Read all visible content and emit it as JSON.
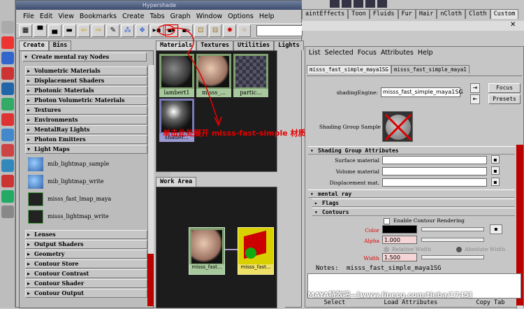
{
  "hypershade": {
    "title": "Hypershade",
    "menu": [
      "File",
      "Edit",
      "View",
      "Bookmarks",
      "Create",
      "Tabs",
      "Graph",
      "Window",
      "Options",
      "Help"
    ],
    "left_tabs": [
      "Create",
      "Bins"
    ],
    "create_header": "Create mental ray Nodes",
    "sections_top": [
      "Volumetric Materials",
      "Displacement Shaders",
      "Photonic Materials",
      "Photon Volumetric Materials",
      "Textures",
      "Environments",
      "MentalRay Lights",
      "Photon Emitters",
      "Light Maps"
    ],
    "light_map_items": [
      "mib_lightmap_sample",
      "mib_lightmap_write",
      "misss_fast_lmap_maya",
      "misss_lightmap_write"
    ],
    "sections_bottom": [
      "Lenses",
      "Output Shaders",
      "Geometry",
      "Contour Store",
      "Contour Contrast",
      "Contour Shader",
      "Contour Output"
    ],
    "material_tabs": [
      "Materials",
      "Textures",
      "Utilities",
      "Lights"
    ],
    "swatches": [
      "lambert1",
      "misss_...",
      "partic...",
      "shader..."
    ],
    "work_area_tab": "Work Area",
    "work_nodes": [
      "misss_fast...",
      "misss_fast..."
    ]
  },
  "annotation": "单击此处展开 misss-fast-simple 材质球",
  "shelf_tabs": [
    "aintEffects",
    "Toon",
    "Fluids",
    "Fur",
    "Hair",
    "nCloth",
    "Cloth",
    "Custom"
  ],
  "attribute_editor": {
    "menu": [
      "List",
      "Selected",
      "Focus",
      "Attributes",
      "Help"
    ],
    "tabs": [
      "misss_fast_simple_maya1SG",
      "misss_fast_simple_maya1"
    ],
    "shading_engine_label": "shadingEngine:",
    "shading_engine_value": "misss_fast_simple_maya1SG",
    "focus_button": "Focus",
    "presets_button": "Presets",
    "sample_label": "Shading Group Sample",
    "sg_attrs_header": "Shading Group Attributes",
    "surface_label": "Surface material",
    "volume_label": "Volume material",
    "displacement_label": "Displacement mat.",
    "mental_ray_header": "mental ray",
    "flags_header": "Flags",
    "contours_header": "Contours",
    "enable_contour": "Enable Contour Rendering",
    "color_label": "Color",
    "alpha_label": "Alpha",
    "alpha_value": "1.000",
    "relative_width": "Relative Width",
    "absolute_width": "Absolute Width",
    "width_label": "Width",
    "width_value": "1.500",
    "notes_label": "Notes:",
    "notes_value": "misss_fast_simple_maya1SG",
    "bottom_buttons": [
      "Select",
      "Load Attributes",
      "Copy Tab"
    ]
  },
  "watermark": "MAYA特效吧—[www.linecg.com/tieba/1745]",
  "colors": {
    "accent_red": "#e60000",
    "swatch_green": "#a7c89c",
    "node_yellow": "#e6d800"
  }
}
